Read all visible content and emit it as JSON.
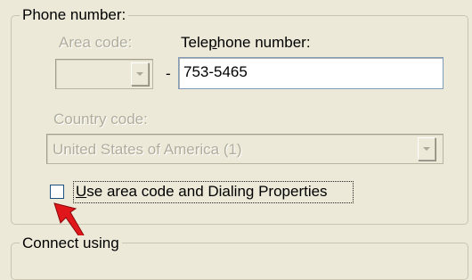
{
  "phone_group": {
    "legend": "Phone number:",
    "area_code_label": "Area code:",
    "area_code_value": "",
    "separator": "-",
    "telephone_label": "Telephone number:",
    "telephone_value": "753-5465",
    "country_code_label": "Country code:",
    "country_code_value": "United States of America (1)",
    "checkbox_label": "Use area code and Dialing Properties",
    "checkbox_checked": false
  },
  "connect_group": {
    "legend": "Connect using"
  },
  "icons": {
    "area_dropdown": "chevron-down-icon",
    "country_dropdown": "chevron-down-icon",
    "pointer": "red-arrow-pointer-icon"
  },
  "colors": {
    "dialog_bg": "#ece9d8",
    "disabled_text": "#b1ad9c",
    "pointer_red": "#e0161b"
  }
}
